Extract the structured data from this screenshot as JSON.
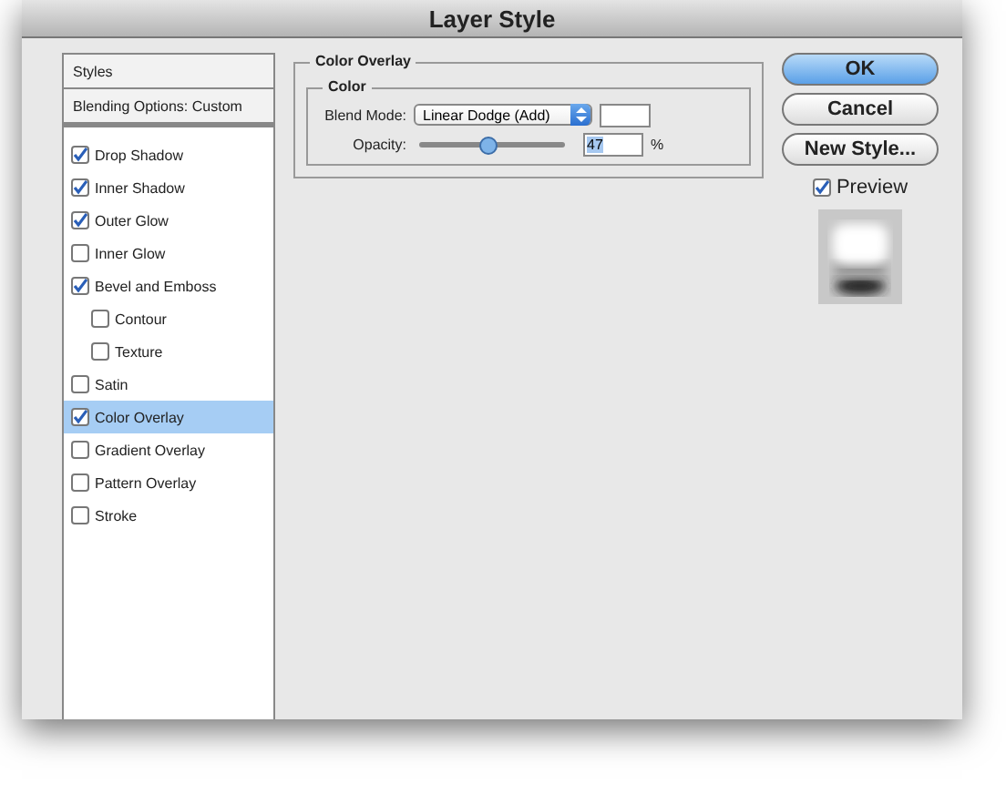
{
  "window": {
    "title": "Layer Style"
  },
  "sidebar": {
    "header": "Styles",
    "blending": "Blending Options: Custom",
    "items": [
      {
        "label": "Drop Shadow",
        "checked": true,
        "selected": false
      },
      {
        "label": "Inner Shadow",
        "checked": true,
        "selected": false
      },
      {
        "label": "Outer Glow",
        "checked": true,
        "selected": false
      },
      {
        "label": "Inner Glow",
        "checked": false,
        "selected": false
      },
      {
        "label": "Bevel and Emboss",
        "checked": true,
        "selected": false,
        "children": [
          {
            "label": "Contour",
            "checked": false,
            "selected": false
          },
          {
            "label": "Texture",
            "checked": false,
            "selected": false
          }
        ]
      },
      {
        "label": "Satin",
        "checked": false,
        "selected": false
      },
      {
        "label": "Color Overlay",
        "checked": true,
        "selected": true
      },
      {
        "label": "Gradient Overlay",
        "checked": false,
        "selected": false
      },
      {
        "label": "Pattern Overlay",
        "checked": false,
        "selected": false
      },
      {
        "label": "Stroke",
        "checked": false,
        "selected": false
      }
    ]
  },
  "panel": {
    "title": "Color Overlay",
    "group": "Color",
    "blend_label": "Blend Mode:",
    "blend_value": "Linear Dodge (Add)",
    "color": "#ffffff",
    "opacity_label": "Opacity:",
    "opacity": {
      "level": 0.47,
      "value": "47",
      "unit": "%"
    }
  },
  "buttons": [
    {
      "label": "OK",
      "kind": "default"
    },
    {
      "label": "Cancel",
      "kind": "normal"
    },
    {
      "label": "New Style...",
      "kind": "normal"
    }
  ],
  "preview": {
    "label": "Preview",
    "checked": true
  }
}
